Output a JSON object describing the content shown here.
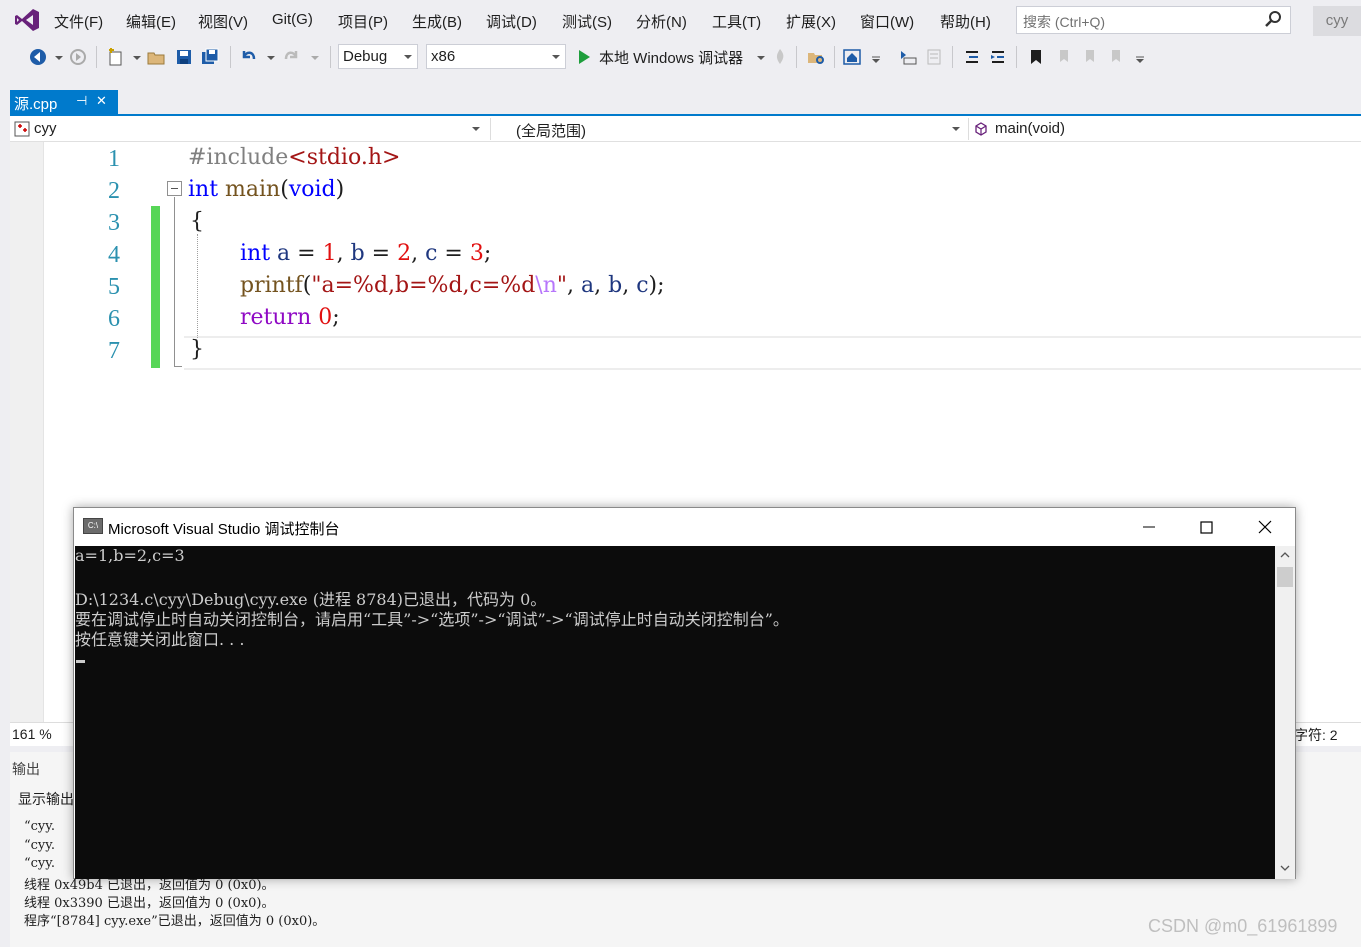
{
  "menu": {
    "items": [
      "文件(F)",
      "编辑(E)",
      "视图(V)",
      "Git(G)",
      "项目(P)",
      "生成(B)",
      "调试(D)",
      "测试(S)",
      "分析(N)",
      "工具(T)",
      "扩展(X)",
      "窗口(W)",
      "帮助(H)"
    ],
    "search_placeholder": "搜索 (Ctrl+Q)",
    "user": "cyy"
  },
  "toolbar": {
    "config": "Debug",
    "platform": "x86",
    "run_label": "本地 Windows 调试器"
  },
  "tab": {
    "filename": "源.cpp",
    "pin": "ᵩ",
    "close": "✕"
  },
  "navbar": {
    "project": "cyy",
    "scope": "(全局范围)",
    "member": "main(void)"
  },
  "editor": {
    "line_numbers": [
      "1",
      "2",
      "3",
      "4",
      "5",
      "6",
      "7"
    ],
    "zoom": "161 %",
    "char_info": "字符: 2"
  },
  "output": {
    "title": "输出",
    "source_label": "显示输出",
    "lines": [
      "“cyy.",
      "“cyy.",
      "“cyy.",
      "线程 0x49b4 已退出，返回值为 0 (0x0)。",
      "线程 0x3390 已退出，返回值为 0 (0x0)。",
      "程序“[8784] cyy.exe”已退出，返回值为 0 (0x0)。"
    ]
  },
  "console": {
    "title": "Microsoft Visual Studio 调试控制台",
    "icon_text": "C:\\",
    "lines": [
      "a=1,b=2,c=3",
      "",
      "D:\\1234.c\\cyy\\Debug\\cyy.exe (进程 8784)已退出，代码为 0。",
      "要在调试停止时自动关闭控制台，请启用“工具”->“选项”->“调试”->“调试停止时自动关闭控制台”。",
      "按任意键关闭此窗口. . ."
    ]
  },
  "watermark": "CSDN @m0_61961899"
}
